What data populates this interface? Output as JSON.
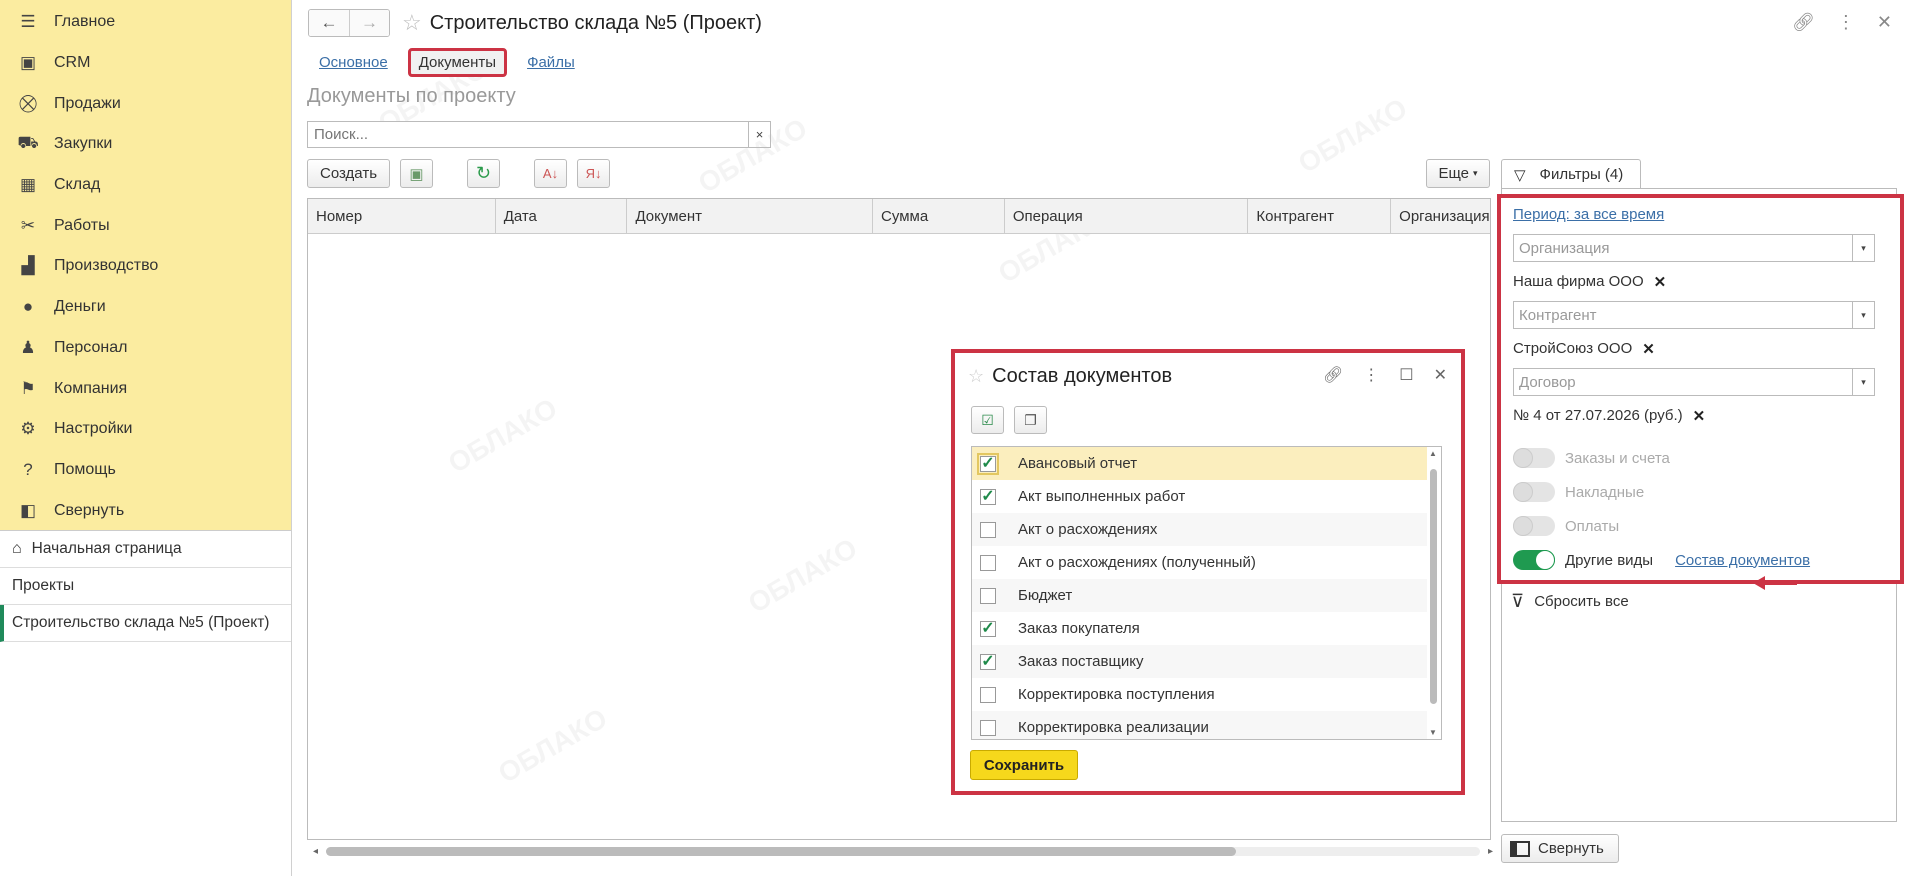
{
  "sidebar": {
    "items": [
      {
        "label": "Главное",
        "icon": "menu-icon"
      },
      {
        "label": "CRM",
        "icon": "crm-icon"
      },
      {
        "label": "Продажи",
        "icon": "basket-icon"
      },
      {
        "label": "Закупки",
        "icon": "cart-icon"
      },
      {
        "label": "Склад",
        "icon": "warehouse-icon"
      },
      {
        "label": "Работы",
        "icon": "tools-icon"
      },
      {
        "label": "Производство",
        "icon": "factory-icon"
      },
      {
        "label": "Деньги",
        "icon": "money-icon"
      },
      {
        "label": "Персонал",
        "icon": "people-icon"
      },
      {
        "label": "Компания",
        "icon": "flag-icon"
      },
      {
        "label": "Настройки",
        "icon": "gear-icon"
      },
      {
        "label": "Помощь",
        "icon": "help-icon"
      },
      {
        "label": "Свернуть",
        "icon": "collapse-icon"
      }
    ],
    "nav": {
      "home": "Начальная страница",
      "projects": "Проекты",
      "current": "Строительство склада №5 (Проект)"
    }
  },
  "header": {
    "title": "Строительство склада №5 (Проект)"
  },
  "tabs": {
    "main": "Основное",
    "documents": "Документы",
    "files": "Файлы"
  },
  "section_title": "Документы по проекту",
  "search": {
    "placeholder": "Поиск...",
    "clear": "×"
  },
  "toolbar": {
    "create": "Создать",
    "more": "Еще"
  },
  "table": {
    "columns": [
      "Номер",
      "Дата",
      "Документ",
      "Сумма",
      "Операция",
      "Контрагент",
      "Организация"
    ]
  },
  "filters": {
    "tab_label": "Фильтры (4)",
    "period_link": "Период: за все время",
    "org_placeholder": "Организация",
    "org_value": "Наша фирма ООО",
    "contractor_placeholder": "Контрагент",
    "contractor_value": "СтройСоюз ООО",
    "contract_placeholder": "Договор",
    "contract_value": "№ 4 от 27.07.2026 (руб.)",
    "toggles": [
      {
        "label": "Заказы и счета",
        "on": false
      },
      {
        "label": "Накладные",
        "on": false
      },
      {
        "label": "Оплаты",
        "on": false
      },
      {
        "label": "Другие виды",
        "on": true
      }
    ],
    "docs_link": "Состав документов",
    "reset": "Сбросить все",
    "collapse": "Свернуть"
  },
  "dialog": {
    "title": "Состав документов",
    "items": [
      {
        "label": "Авансовый отчет",
        "checked": true
      },
      {
        "label": "Акт выполненных работ",
        "checked": true
      },
      {
        "label": "Акт о расхождениях",
        "checked": false
      },
      {
        "label": "Акт о расхождениях (полученный)",
        "checked": false
      },
      {
        "label": "Бюджет",
        "checked": false
      },
      {
        "label": "Заказ покупателя",
        "checked": true
      },
      {
        "label": "Заказ поставщику",
        "checked": true
      },
      {
        "label": "Корректировка поступления",
        "checked": false
      },
      {
        "label": "Корректировка реализации",
        "checked": false
      }
    ],
    "save": "Сохранить"
  },
  "watermark": "ОБЛАКО",
  "colors": {
    "accent_red": "#cc3344",
    "sidebar_yellow": "#fbeca0",
    "save_yellow": "#f6d81c",
    "toggle_green": "#1f9a50"
  }
}
